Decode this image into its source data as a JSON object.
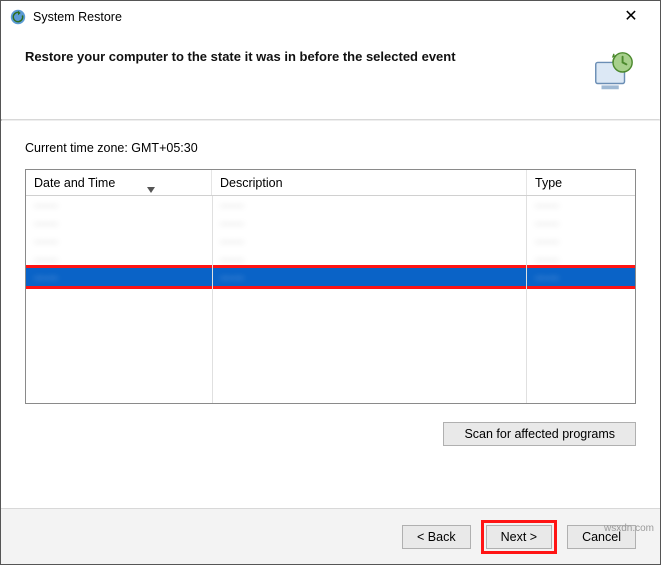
{
  "window": {
    "title": "System Restore",
    "close_glyph": "✕"
  },
  "header": {
    "heading": "Restore your computer to the state it was in before the selected event"
  },
  "timezone_label": "Current time zone: GMT+05:30",
  "table": {
    "headers": {
      "date": "Date and Time",
      "desc": "Description",
      "type": "Type"
    },
    "rows": [
      {
        "date": "——",
        "desc": "——",
        "type": "——",
        "selected": false
      },
      {
        "date": "——",
        "desc": "——",
        "type": "——",
        "selected": false
      },
      {
        "date": "——",
        "desc": "——",
        "type": "——",
        "selected": false
      },
      {
        "date": "——",
        "desc": "——",
        "type": "——",
        "selected": false
      },
      {
        "date": "——",
        "desc": "——",
        "type": "——",
        "selected": true
      }
    ]
  },
  "scan_button": "Scan for affected programs",
  "footer": {
    "back": "< Back",
    "next": "Next >",
    "cancel": "Cancel"
  },
  "watermark": "wsxdn.com"
}
